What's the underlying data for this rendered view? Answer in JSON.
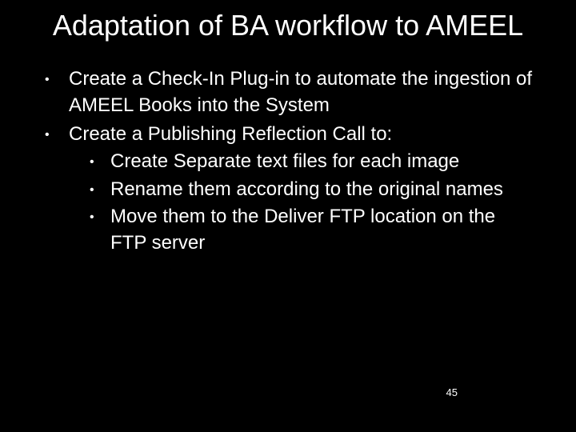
{
  "title": "Adaptation of BA workflow to AMEEL",
  "bullets": {
    "b0": "Create a Check-In Plug-in to  automate the ingestion of AMEEL Books into the System",
    "b1": "Create a Publishing Reflection Call to:",
    "b1_sub": {
      "s0": "Create Separate text files for each image",
      "s1": "Rename them according to the original names",
      "s2": "Move them to the Deliver FTP location on the FTP server"
    }
  },
  "page_number": "45"
}
